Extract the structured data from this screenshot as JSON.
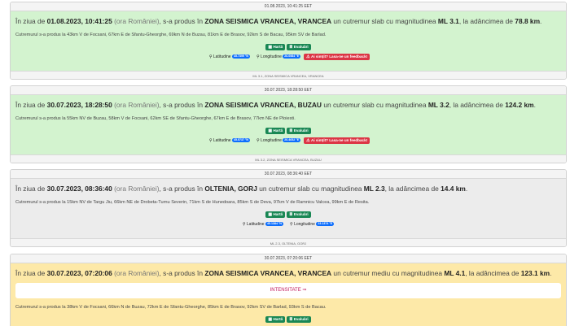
{
  "events": [
    {
      "timestamp": "01.08.2023, 10:41:25 EET",
      "headline": {
        "prefix": "În ziua de",
        "date": "01.08.2023, 10:41:25",
        "tz": "(ora României)",
        "mid1": ", s-a produs în",
        "zone": "ZONA SEISMICA VRANCEA, VRANCEA",
        "mid2": "un cutremur slab cu magnitudinea",
        "magnitude": "ML 3.1",
        "mid3": ", la adâncimea de",
        "depth": "78.8 km",
        "end": "."
      },
      "details": "Cutremurul s-a produs la 43km V de Focsani, 67km E de Sfantu-Gheorghe, 69km N de Buzau, 81km E de Brasov, 92km S de Bacau, 95km SV de Barlad.",
      "latitude": "45.7399 °N",
      "longitude": "26.6984 °E",
      "footer": "ML 3.1, ZONA SEISMICA VRANCEA, VRANCEA"
    },
    {
      "timestamp": "30.07.2023, 18:28:50 EET",
      "headline": {
        "prefix": "În ziua de",
        "date": "30.07.2023, 18:28:50",
        "tz": "(ora României)",
        "mid1": ", s-a produs în",
        "zone": "ZONA SEISMICA VRANCEA, BUZAU",
        "mid2": "un cutremur slab cu magnitudinea",
        "magnitude": "ML 3.2",
        "mid3": ", la adâncimea de",
        "depth": "124.2 km",
        "end": "."
      },
      "details": "Cutremurul s-a produs la 55km NV de Buzau, 58km V de Focsani, 62km SE de Sfantu-Gheorghe, 67km E de Brasov, 77km NE de Ploiesti.",
      "latitude": "45.5737 °N",
      "longitude": "26.4652 °E",
      "footer": "ML 3.2, ZONA SEISMICA VRANCEA, BUZAU"
    },
    {
      "timestamp": "30.07.2023, 08:36:40 EET",
      "headline": {
        "prefix": "În ziua de",
        "date": "30.07.2023, 08:36:40",
        "tz": "(ora României)",
        "mid1": ", s-a produs în",
        "zone": "OLTENIA, GORJ",
        "mid2": "un cutremur slab cu magnitudinea",
        "magnitude": "ML 2.3",
        "mid3": ", la adâncimea de",
        "depth": "14.4 km",
        "end": "."
      },
      "details": "Cutremurul s-a produs la 15km NV de Targu Jiu, 66km NE de Drobeta-Turnu Severin, 71km S de Hunedoara, 85km S de Deva, 97km V de Ramnicu Valcea, 99km E de Resita.",
      "latitude": "45.1384 °N",
      "longitude": "23.1374 °E",
      "footer": "ML 2.3, OLTENIA, GORJ"
    },
    {
      "timestamp": "30.07.2023, 07:20:06 EET",
      "headline": {
        "prefix": "În ziua de",
        "date": "30.07.2023, 07:20:06",
        "tz": "(ora României)",
        "mid1": ", s-a produs în",
        "zone": "ZONA SEISMICA VRANCEA, VRANCEA",
        "mid2": "un cutremur mediu cu magnitudinea",
        "magnitude": "ML 4.1",
        "mid3": ", la adâncimea de",
        "depth": "123.1 km",
        "end": "."
      },
      "intensity_label": "INTENSITATE ⇒",
      "details": "Cutremurul s-a produs la 38km V de Focsani, 66km N de Buzau, 72km E de Sfantu-Gheorghe, 85km E de Brasov, 92km SV de Barlad, 93km S de Bacau."
    }
  ],
  "labels": {
    "map": "Hartă",
    "evaluate": "Evaluări",
    "latitude": "Latitudine",
    "longitude": "Longitudine",
    "feedback": "Ai simțit? Lasa-ne un feedback!"
  },
  "icons": {
    "map": "map-icon",
    "evaluate": "list-icon",
    "location": "map-pin-icon",
    "feedback": "alert-icon",
    "scroll": "scroll-dot"
  },
  "colors": {
    "weak_bg": "#d3f3cf",
    "normal_bg": "#ececec",
    "medium_bg": "#fde9a8",
    "primary": "#0d6efd",
    "success": "#198754",
    "danger": "#dc3545"
  }
}
